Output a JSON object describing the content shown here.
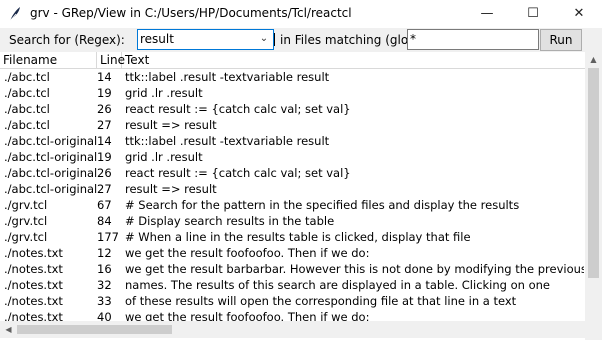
{
  "window": {
    "title": "grv - GRep/View in C:/Users/HP/Documents/Tcl/reactcl",
    "minimize_glyph": "—",
    "maximize_glyph": "☐",
    "close_glyph": "✕"
  },
  "toolbar": {
    "search_label": "Search for (Regex):",
    "search_value": "result",
    "files_label": "in Files matching (glob):",
    "files_value": "*",
    "run_label": "Run"
  },
  "table": {
    "columns": [
      "Filename",
      "Line",
      "Text"
    ],
    "rows": [
      {
        "file": "./abc.tcl",
        "line": "14",
        "text": "ttk::label .result -textvariable result"
      },
      {
        "file": "./abc.tcl",
        "line": "19",
        "text": "grid .lr .result"
      },
      {
        "file": "./abc.tcl",
        "line": "26",
        "text": "react result := {catch calc val; set val}"
      },
      {
        "file": "./abc.tcl",
        "line": "27",
        "text": "result => result"
      },
      {
        "file": "./abc.tcl-original",
        "line": "14",
        "text": "ttk::label .result -textvariable result"
      },
      {
        "file": "./abc.tcl-original",
        "line": "19",
        "text": "grid .lr .result"
      },
      {
        "file": "./abc.tcl-original",
        "line": "26",
        "text": "react result := {catch calc val; set val}"
      },
      {
        "file": "./abc.tcl-original",
        "line": "27",
        "text": "result => result"
      },
      {
        "file": "./grv.tcl",
        "line": "67",
        "text": "# Search for the pattern in the specified files and display the results"
      },
      {
        "file": "./grv.tcl",
        "line": "84",
        "text": "# Display search results in the table"
      },
      {
        "file": "./grv.tcl",
        "line": "177",
        "text": "# When a line in the results table is clicked, display that file"
      },
      {
        "file": "./notes.txt",
        "line": "12",
        "text": "we get the result foofoofoo.  Then if we do:"
      },
      {
        "file": "./notes.txt",
        "line": "16",
        "text": "we get the result barbarbar.  However this is not done by modifying the previous reacti"
      },
      {
        "file": "./notes.txt",
        "line": "32",
        "text": "names.  The results of this search are displayed in a table.  Clicking on one"
      },
      {
        "file": "./notes.txt",
        "line": "33",
        "text": "of these results will open the corresponding file at that line in a text"
      },
      {
        "file": "./notes.txt",
        "line": "40",
        "text": "we get the result foofoofoo.  Then if we do:"
      }
    ]
  },
  "icons": {
    "app": "feather-icon",
    "dropdown": "chevron-down-icon",
    "scroll_up": "arrow-up-icon",
    "scroll_left": "arrow-left-icon"
  },
  "colors": {
    "focus_border": "#0078d7",
    "toolbar_bg": "#f0f0f0",
    "scrollbar_thumb": "#cdcdcd"
  }
}
